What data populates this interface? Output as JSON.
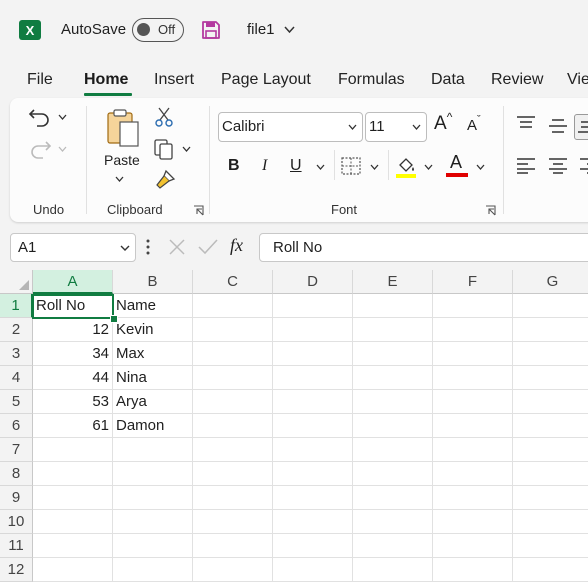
{
  "titlebar": {
    "app_icon_letter": "X",
    "autosave_label": "AutoSave",
    "autosave_state": "Off",
    "filename": "file1"
  },
  "ribbon_tabs": [
    "File",
    "Home",
    "Insert",
    "Page Layout",
    "Formulas",
    "Data",
    "Review",
    "Vie"
  ],
  "active_tab": "Home",
  "ribbon": {
    "undo_group_label": "Undo",
    "clipboard_group_label": "Clipboard",
    "paste_label": "Paste",
    "font_group_label": "Font",
    "font_name": "Calibri",
    "font_size": "11",
    "bold_label": "B",
    "italic_label": "I",
    "underline_label": "U",
    "font_color_label": "A",
    "grow_font_label": "A",
    "shrink_font_label": "A",
    "highlight_color": "#ffff00",
    "font_color": "#e00000"
  },
  "formula_bar": {
    "name_box": "A1",
    "fx_label": "fx",
    "content": "Roll No"
  },
  "sheet": {
    "columns": [
      "A",
      "B",
      "C",
      "D",
      "E",
      "F",
      "G"
    ],
    "selected_column": "A",
    "rows": [
      "1",
      "2",
      "3",
      "4",
      "5",
      "6",
      "7",
      "8",
      "9",
      "10",
      "11",
      "12"
    ],
    "selected_row": "1",
    "cells": [
      [
        "Roll No",
        "Name"
      ],
      [
        "12",
        "Kevin"
      ],
      [
        "34",
        "Max"
      ],
      [
        "44",
        "Nina"
      ],
      [
        "53",
        "Arya"
      ],
      [
        "61",
        "Damon"
      ]
    ]
  },
  "colors": {
    "accent": "#107c41",
    "background": "#f3f3f3"
  }
}
